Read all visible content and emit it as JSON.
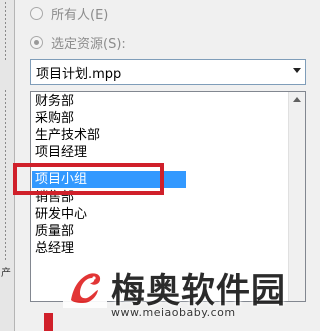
{
  "options": {
    "everyone_label": "所有人(E)",
    "selected_resource_label": "选定资源(S):"
  },
  "combo": {
    "value": "项目计划.mpp"
  },
  "resource_list": {
    "items": [
      "财务部",
      "采购部",
      "生产技术部",
      "项目经理",
      "项目小组",
      "销售部",
      "研发中心",
      "质量部",
      "总经理"
    ],
    "selected_index": 4
  },
  "watermark": {
    "brand": "梅奥软件园",
    "url": "www.meiaobaby.com"
  },
  "colors": {
    "selection": "#3399ff",
    "highlight_annotation": "#d0202a"
  }
}
